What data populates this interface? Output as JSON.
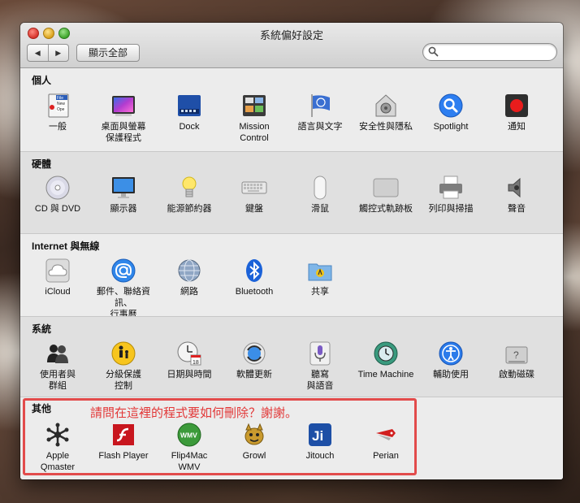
{
  "window": {
    "title": "系統偏好設定",
    "nav_back": "◀",
    "nav_forward": "▶",
    "show_all": "顯示全部",
    "search": {
      "value": "",
      "placeholder": ""
    }
  },
  "sections": [
    {
      "title": "個人",
      "items": [
        {
          "label": "一般",
          "icon": "general-icon"
        },
        {
          "label": "桌面與螢幕\n保護程式",
          "icon": "desktop-screensaver-icon"
        },
        {
          "label": "Dock",
          "icon": "dock-icon"
        },
        {
          "label": "Mission\nControl",
          "icon": "mission-control-icon"
        },
        {
          "label": "語言與文字",
          "icon": "language-text-icon"
        },
        {
          "label": "安全性與隱私",
          "icon": "security-privacy-icon"
        },
        {
          "label": "Spotlight",
          "icon": "spotlight-icon"
        },
        {
          "label": "通知",
          "icon": "notifications-icon"
        }
      ]
    },
    {
      "title": "硬體",
      "items": [
        {
          "label": "CD 與 DVD",
          "icon": "cd-dvd-icon"
        },
        {
          "label": "顯示器",
          "icon": "displays-icon"
        },
        {
          "label": "能源節約器",
          "icon": "energy-saver-icon"
        },
        {
          "label": "鍵盤",
          "icon": "keyboard-icon"
        },
        {
          "label": "滑鼠",
          "icon": "mouse-icon"
        },
        {
          "label": "觸控式軌跡板",
          "icon": "trackpad-icon"
        },
        {
          "label": "列印與掃描",
          "icon": "print-scan-icon"
        },
        {
          "label": "聲音",
          "icon": "sound-icon"
        }
      ]
    },
    {
      "title": "Internet 與無線",
      "items": [
        {
          "label": "iCloud",
          "icon": "icloud-icon"
        },
        {
          "label": "郵件、聯絡資訊、\n行事曆",
          "icon": "mail-contacts-calendars-icon"
        },
        {
          "label": "網路",
          "icon": "network-icon"
        },
        {
          "label": "Bluetooth",
          "icon": "bluetooth-icon"
        },
        {
          "label": "共享",
          "icon": "sharing-icon"
        }
      ]
    },
    {
      "title": "系統",
      "items": [
        {
          "label": "使用者與\n群組",
          "icon": "users-groups-icon"
        },
        {
          "label": "分級保護\n控制",
          "icon": "parental-controls-icon"
        },
        {
          "label": "日期與時間",
          "icon": "date-time-icon"
        },
        {
          "label": "軟體更新",
          "icon": "software-update-icon"
        },
        {
          "label": "聽寫\n與語音",
          "icon": "dictation-speech-icon"
        },
        {
          "label": "Time Machine",
          "icon": "time-machine-icon"
        },
        {
          "label": "輔助使用",
          "icon": "accessibility-icon"
        },
        {
          "label": "啟動磁碟",
          "icon": "startup-disk-icon"
        }
      ]
    },
    {
      "title": "其他",
      "items": [
        {
          "label": "Apple\nQmaster",
          "icon": "apple-qmaster-icon"
        },
        {
          "label": "Flash Player",
          "icon": "flash-player-icon"
        },
        {
          "label": "Flip4Mac\nWMV",
          "icon": "flip4mac-icon",
          "icon_text": "WMV"
        },
        {
          "label": "Growl",
          "icon": "growl-icon"
        },
        {
          "label": "Jitouch",
          "icon": "jitouch-icon",
          "icon_text": "Ji"
        },
        {
          "label": "Perian",
          "icon": "perian-icon"
        }
      ]
    }
  ],
  "general_icon_text": [
    "File",
    "New",
    "Ope"
  ],
  "date_icon_text": "18",
  "annotation": {
    "text": "請問在這裡的程式要如何刪除？謝謝。",
    "color": "#e23838"
  }
}
